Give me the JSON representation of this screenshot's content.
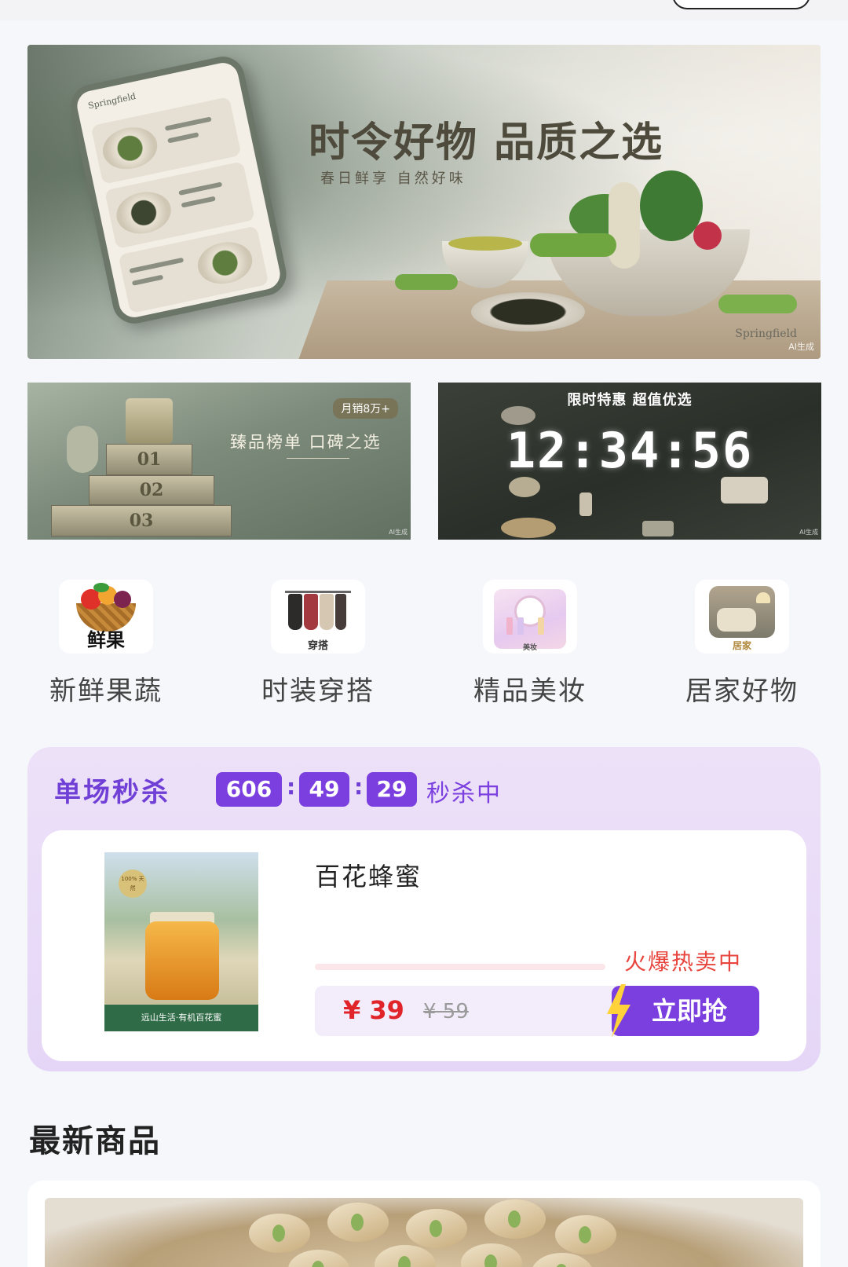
{
  "hero": {
    "title": "时令好物 品质之选",
    "subtitle": "春日鲜享 自然好味",
    "brand": "Springfield",
    "ai_mark": "AI生成",
    "phone_brand": "Springfield"
  },
  "banners": {
    "left": {
      "title": "臻品榜单 口碑之选",
      "badge": "月销8万+",
      "tiers": [
        "01",
        "02",
        "03"
      ]
    },
    "right": {
      "title": "限时特惠 超值优选",
      "clock": "12:34:56"
    }
  },
  "categories": [
    {
      "label": "新鲜果蔬",
      "icon_caption": "鲜果",
      "icon": "fruit-basket-icon"
    },
    {
      "label": "时装穿搭",
      "icon_caption": "穿搭",
      "icon": "clothing-rack-icon"
    },
    {
      "label": "精品美妆",
      "icon_caption": "美妆",
      "icon": "vanity-icon"
    },
    {
      "label": "居家好物",
      "icon_caption": "居家",
      "icon": "home-sofa-icon"
    }
  ],
  "flash_sale": {
    "title": "单场秒杀",
    "hours": "606",
    "minutes": "49",
    "seconds": "29",
    "status": "秒杀中",
    "product": {
      "name": "百花蜂蜜",
      "hot_text": "火爆热卖中",
      "price": "¥ 39",
      "original_price": "¥ 59",
      "buy_label": "立即抢",
      "image_caption": "远山生活·有机百花蜜",
      "image_seal": "100% 天然"
    }
  },
  "latest": {
    "title": "最新商品"
  },
  "colors": {
    "accent": "#7b3fe0",
    "price": "#e0242a",
    "hot": "#e8453e"
  }
}
